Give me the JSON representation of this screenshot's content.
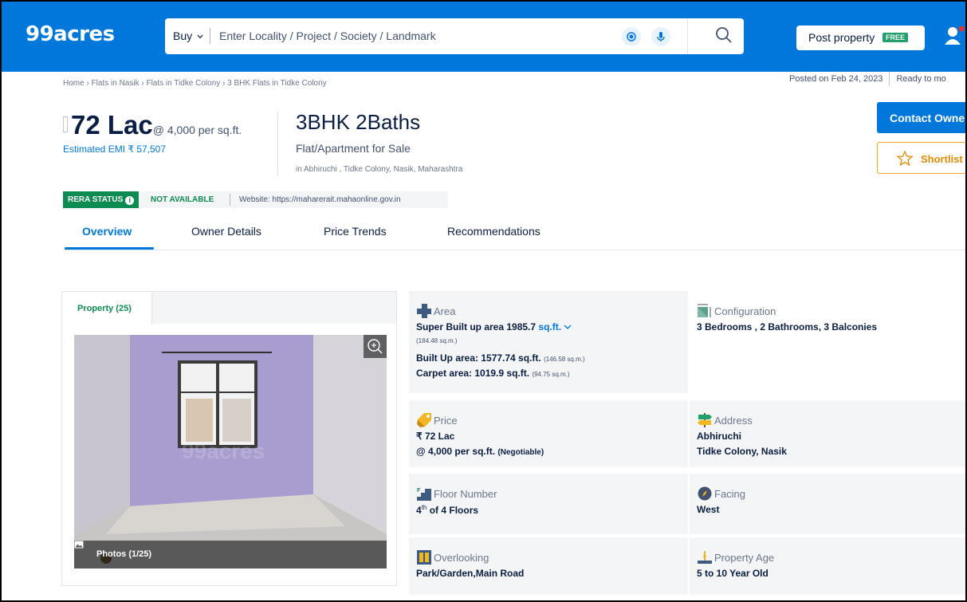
{
  "header": {
    "logo": "99acres",
    "buy_label": "Buy",
    "search_placeholder": "Enter Locality / Project / Society / Landmark",
    "post_property_label": "Post property",
    "free_badge": "FREE"
  },
  "breadcrumb": "Home › Flats in Nasik › Flats in Tidke Colony › 3 BHK Flats in Tidke Colony",
  "posted": {
    "date": "Posted on Feb 24, 2023",
    "status": "Ready to mo"
  },
  "listing": {
    "price": "72 Lac",
    "price_per_sqft": "@ 4,000 per sq.ft.",
    "emi": "Estimated EMI ₹ 57,507",
    "title": "3BHK 2Baths",
    "type": "Flat/Apartment for Sale",
    "locality": "in Abhiruchi , Tidke Colony, Nasik, Maharashtra"
  },
  "actions": {
    "contact": "Contact Owne",
    "shortlist": "Shortlist"
  },
  "rera": {
    "label": "RERA STATUS",
    "value": "NOT AVAILABLE",
    "website": "Website: https://maharerait.mahaonline.gov.in"
  },
  "tabs": [
    {
      "label": "Overview"
    },
    {
      "label": "Owner Details"
    },
    {
      "label": "Price Trends"
    },
    {
      "label": "Recommendations"
    }
  ],
  "gallery": {
    "tab": "Property (25)",
    "photos_count": "Photos (1/25)",
    "watermark": "99acres"
  },
  "details": {
    "area": {
      "heading": "Area",
      "super_built_up": "Super Built up area 1985.7",
      "unit": "sq.ft.",
      "super_sqm": "(184.48 sq.m.)",
      "built_up": "Built Up area: 1577.74 sq.ft.",
      "built_up_sqm": "(146.58 sq.m.)",
      "carpet": "Carpet area: 1019.9 sq.ft.",
      "carpet_sqm": "(94.75 sq.m.)"
    },
    "configuration": {
      "heading": "Configuration",
      "value": "3 Bedrooms , 2 Bathrooms, 3 Balconies"
    },
    "price": {
      "heading": "Price",
      "value": "₹ 72 Lac",
      "per_sqft": "@ 4,000 per sq.ft.",
      "negotiable": "(Negotiable)"
    },
    "address": {
      "heading": "Address",
      "line1": "Abhiruchi",
      "line2": "Tidke Colony, Nasik"
    },
    "floor": {
      "heading": "Floor Number",
      "floor": "4",
      "suffix": "th",
      "of_floors": "of 4 Floors"
    },
    "facing": {
      "heading": "Facing",
      "value": "West"
    },
    "overlooking": {
      "heading": "Overlooking",
      "value": "Park/Garden,Main Road"
    },
    "age": {
      "heading": "Property Age",
      "value": "5 to 10 Year Old"
    }
  },
  "colors": {
    "brand_blue": "#0078db",
    "rera_green": "#0d8c52",
    "shortlist_orange": "#e58a00"
  }
}
